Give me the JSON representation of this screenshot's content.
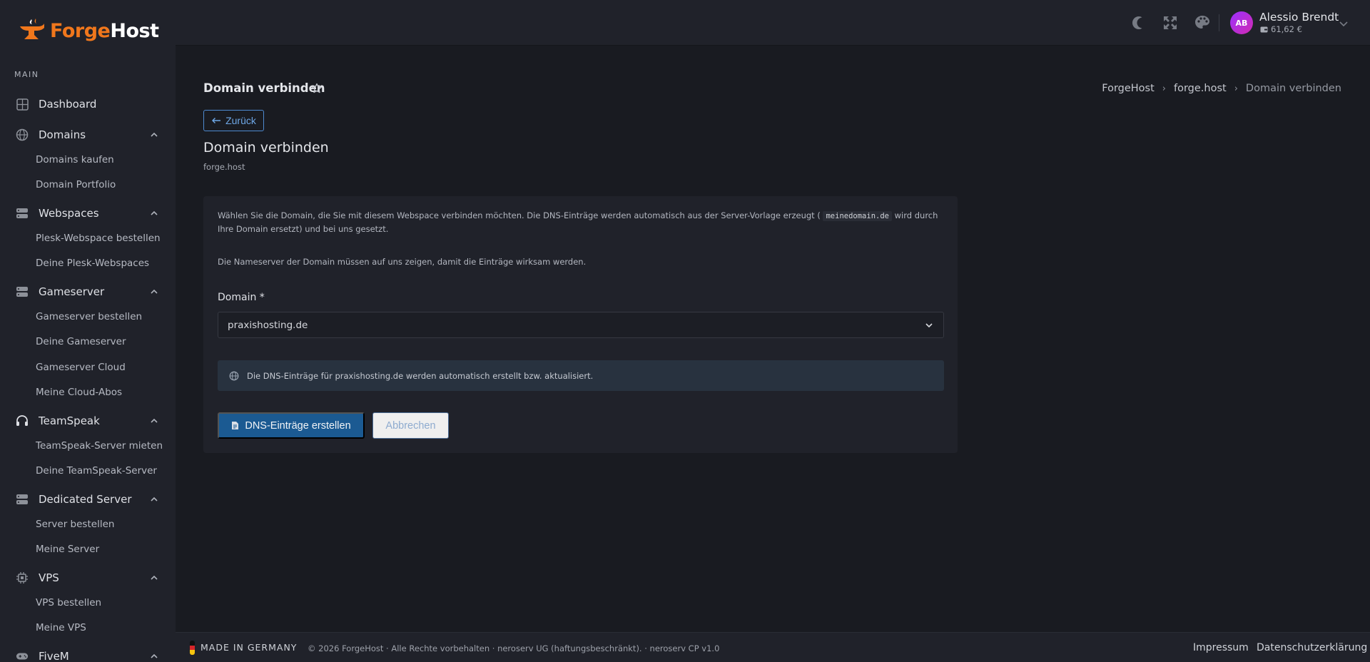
{
  "brand": {
    "part1": "Forge",
    "part2": "Host"
  },
  "sidebar": {
    "section": "MAIN",
    "groups": [
      {
        "label": "Dashboard",
        "icon": "dashboard-icon",
        "items": []
      },
      {
        "label": "Domains",
        "icon": "globe-icon",
        "items": [
          "Domains kaufen",
          "Domain Portfolio"
        ]
      },
      {
        "label": "Webspaces",
        "icon": "server-icon",
        "items": [
          "Plesk-Webspace bestellen",
          "Deine Plesk-Webspaces"
        ]
      },
      {
        "label": "Gameserver",
        "icon": "server-icon",
        "items": [
          "Gameserver bestellen",
          "Deine Gameserver",
          "Gameserver Cloud",
          "Meine Cloud-Abos"
        ]
      },
      {
        "label": "TeamSpeak",
        "icon": "headphones-icon",
        "items": [
          "TeamSpeak-Server mieten",
          "Deine TeamSpeak-Server"
        ]
      },
      {
        "label": "Dedicated Server",
        "icon": "server-icon",
        "items": [
          "Server bestellen",
          "Meine Server"
        ]
      },
      {
        "label": "VPS",
        "icon": "cpu-icon",
        "items": [
          "VPS bestellen",
          "Meine VPS"
        ]
      },
      {
        "label": "FiveM",
        "icon": "gamepad-icon",
        "items": []
      }
    ]
  },
  "user": {
    "initials": "AB",
    "name": "Alessio Brendt",
    "balance": "61,62 €"
  },
  "page": {
    "title": "Domain verbinden",
    "breadcrumb": [
      "ForgeHost",
      "forge.host",
      "Domain verbinden"
    ],
    "back_label": "Zurück",
    "heading": "Domain verbinden",
    "subheading": "forge.host"
  },
  "card": {
    "intro_before": "Wählen Sie die Domain, die Sie mit diesem Webspace verbinden möchten. Die DNS-Einträge werden automatisch aus der Server-Vorlage erzeugt (",
    "intro_code": "meinedomain.de",
    "intro_after": " wird durch Ihre Domain ersetzt) und bei uns gesetzt.",
    "nameserver_note": "Die Nameserver der Domain müssen auf uns zeigen, damit die Einträge wirksam werden.",
    "domain_label": "Domain *",
    "domain_value": "praxishosting.de",
    "info_text": "Die DNS-Einträge für praxishosting.de werden automatisch erstellt bzw. aktualisiert.",
    "submit_label": "DNS-Einträge erstellen",
    "cancel_label": "Abbrechen"
  },
  "footer": {
    "made_in": "MADE IN GERMANY",
    "copyright": "© 2026 ForgeHost · Alle Rechte vorbehalten · neroserv UG (haftungsbeschränkt). · neroserv CP v1.0",
    "links": [
      "Impressum",
      "Datenschutzerklärung"
    ]
  },
  "colors": {
    "accent": "#f0771c",
    "primary": "#1b5a92",
    "background": "#191b21",
    "panel": "#20222a"
  }
}
